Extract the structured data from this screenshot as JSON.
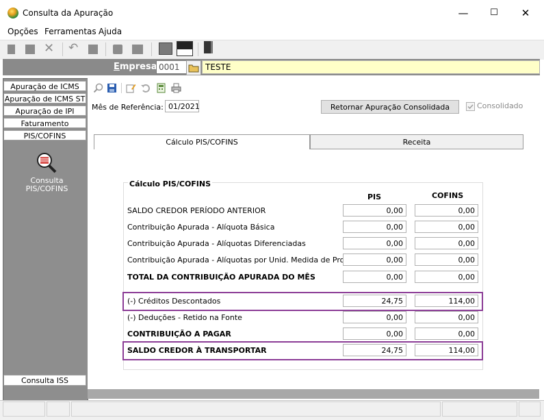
{
  "window": {
    "title": "Consulta da Apuração",
    "minimize": "—",
    "maximize": "☐",
    "close": "✕"
  },
  "menu": [
    "Opções",
    "Ferramentas",
    "Ajuda"
  ],
  "empresa": {
    "label": "Empresa",
    "code": "0001",
    "name": "TESTE"
  },
  "leftnav": {
    "tabs": [
      "Apuração de ICMS",
      "Apuração de ICMS ST",
      "Apuração de IPI",
      "Faturamento",
      "PIS/COFINS"
    ],
    "item_label": "Consulta\nPIS/COFINS",
    "bottom_tab": "Consulta ISS"
  },
  "form": {
    "mes_label": "Mês de Referência:",
    "mes_value": "01/2021",
    "retornar_button": "Retornar Apuração Consolidada",
    "consolidado_label": "Consolidado",
    "consolidado_checked": true
  },
  "tabs": [
    "Cálculo PIS/COFINS",
    "Receita"
  ],
  "calc": {
    "group_title": "Cálculo PIS/COFINS",
    "col_pis": "PIS",
    "col_cofins": "COFINS",
    "rows": [
      {
        "label": "SALDO CREDOR PERÍODO ANTERIOR",
        "pis": "0,00",
        "cofins": "0,00",
        "bold": false,
        "highlight": false
      },
      {
        "label": "Contribuição Apurada - Alíquota Básica",
        "pis": "0,00",
        "cofins": "0,00",
        "bold": false,
        "highlight": false
      },
      {
        "label": "Contribuição Apurada - Alíquotas Diferenciadas",
        "pis": "0,00",
        "cofins": "0,00",
        "bold": false,
        "highlight": false
      },
      {
        "label": "Contribuição Apurada - Alíquotas por Unid. Medida de Produto",
        "pis": "0,00",
        "cofins": "0,00",
        "bold": false,
        "highlight": false
      },
      {
        "label": "TOTAL DA CONTRIBUIÇÃO APURADA DO MÊS",
        "pis": "0,00",
        "cofins": "0,00",
        "bold": true,
        "highlight": false
      },
      {
        "label": "(-) Créditos Descontados",
        "pis": "24,75",
        "cofins": "114,00",
        "bold": false,
        "highlight": true
      },
      {
        "label": "(-) Deduções - Retido na Fonte",
        "pis": "0,00",
        "cofins": "0,00",
        "bold": false,
        "highlight": false
      },
      {
        "label": "CONTRIBUIÇÃO A PAGAR",
        "pis": "0,00",
        "cofins": "0,00",
        "bold": true,
        "highlight": false
      },
      {
        "label": "SALDO CREDOR À TRANSPORTAR",
        "pis": "24,75",
        "cofins": "114,00",
        "bold": true,
        "highlight": true
      }
    ]
  },
  "colors": {
    "highlight_border": "#8b3c96",
    "empresa_name_bg": "#ffffc8",
    "nav_bg": "#8e8e8e"
  }
}
